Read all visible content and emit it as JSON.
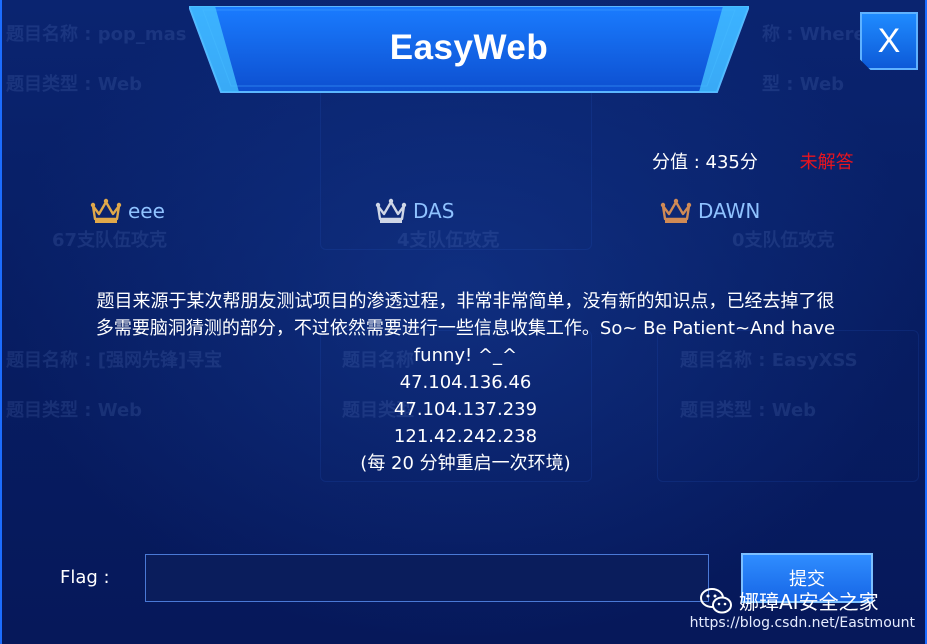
{
  "dialog": {
    "title": "EasyWeb",
    "close_label": "X",
    "score_label": "分值 : 435分",
    "status": "未解答",
    "solvers": [
      {
        "name": "eee",
        "crown": "gold-crown-icon",
        "color": "#e0a84a"
      },
      {
        "name": "DAS",
        "crown": "silver-crown-icon",
        "color": "#cfd6e6"
      },
      {
        "name": "DAWN",
        "crown": "bronze-crown-icon",
        "color": "#d08a55"
      }
    ],
    "description_lines": [
      "题目来源于某次帮朋友测试项目的渗透过程，非常非常简单，没有新的知识点，已经去掉了很",
      "多需要脑洞猜测的部分，不过依然需要进行一些信息收集工作。So~ Be Patient~And have",
      "funny! ^_^",
      "47.104.136.46",
      "47.104.137.239",
      "121.42.242.238",
      "(每 20 分钟重启一次环境)"
    ],
    "flag_label": "Flag :",
    "flag_value": "",
    "submit_label": "提交"
  },
  "background": {
    "card_texts": [
      "题目名称 : pop_mas",
      "题目类型 : Web",
      "67支队伍攻克",
      "4支队伍攻克",
      "0支队伍攻克",
      "题目名称 : [强网先锋]寻宝",
      "题目类型 : Web",
      "题目名称",
      "题目类型",
      "题目名称 : EasyXSS",
      "题目类型 : Web",
      "称 : Wherels",
      "型 : Web"
    ]
  },
  "watermark": {
    "account": "娜璋AI安全之家",
    "url": "https://blog.csdn.net/Eastmount"
  },
  "colors": {
    "accent": "#1c6dff",
    "status_red": "#e8141e",
    "solver_text": "#8fc2ff"
  }
}
